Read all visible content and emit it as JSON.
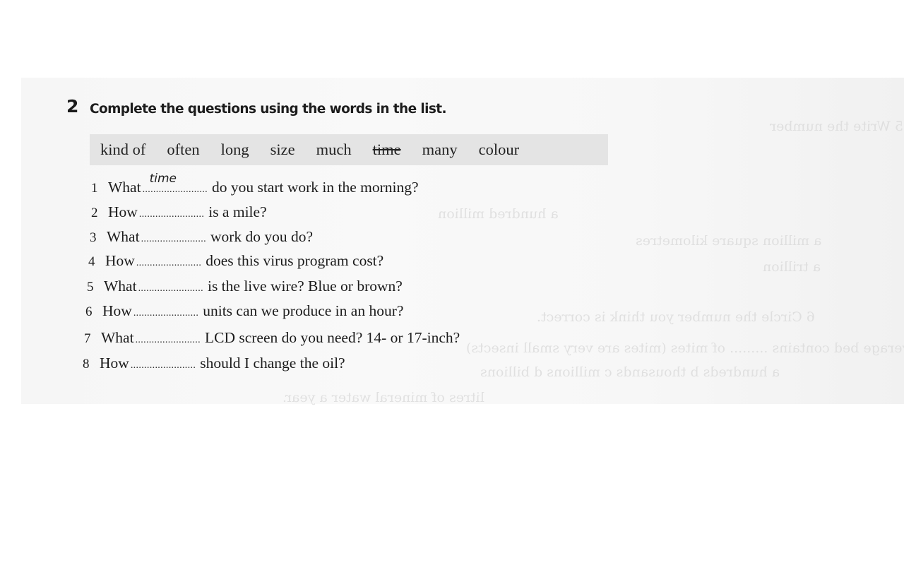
{
  "exercise": {
    "number": "2",
    "instruction": "Complete the questions using the words in the list."
  },
  "word_list": [
    {
      "text": "kind of",
      "struck": false
    },
    {
      "text": "often",
      "struck": false
    },
    {
      "text": "long",
      "struck": false
    },
    {
      "text": "size",
      "struck": false
    },
    {
      "text": "much",
      "struck": false
    },
    {
      "text": "time",
      "struck": true
    },
    {
      "text": "many",
      "struck": false
    },
    {
      "text": "colour",
      "struck": false
    }
  ],
  "blank_dots": "........................",
  "questions": [
    {
      "num": "1",
      "stem": "What",
      "answer": "time",
      "rest": "do you start work in the morning?"
    },
    {
      "num": "2",
      "stem": "How",
      "answer": "",
      "rest": "is a mile?"
    },
    {
      "num": "3",
      "stem": "What",
      "answer": "",
      "rest": "work do you do?"
    },
    {
      "num": "4",
      "stem": "How",
      "answer": "",
      "rest": "does this virus program cost?"
    },
    {
      "num": "5",
      "stem": "What",
      "answer": "",
      "rest": "is the live wire? Blue or brown?"
    },
    {
      "num": "6",
      "stem": "How",
      "answer": "",
      "rest": "units can we produce in an hour?"
    },
    {
      "num": "7",
      "stem": "What",
      "answer": "",
      "rest": "LCD screen do you need? 14- or 17-inch?"
    },
    {
      "num": "8",
      "stem": "How",
      "answer": "",
      "rest": "should I change the oil?"
    }
  ],
  "bleed_through": [
    "5 Write the number",
    "a hundred million",
    "a million square kilometres",
    "a trillion",
    "6 Circle the number you think is correct.",
    "The average bed contains ......... of mites (mites are very small insects)",
    "a hundreds  b thousands  c millions  d billions",
    "litres of mineral water a year."
  ]
}
